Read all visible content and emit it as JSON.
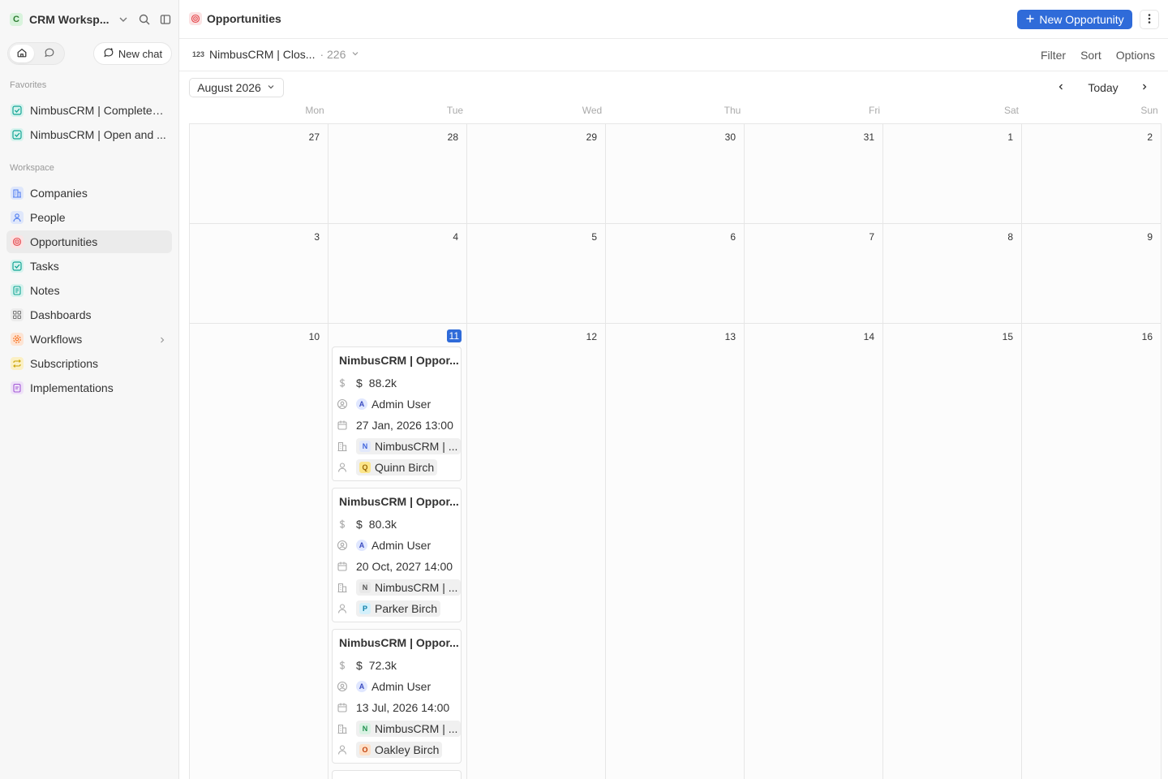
{
  "workspace": {
    "logo_letter": "C",
    "name": "CRM Worksp..."
  },
  "sidebar": {
    "new_chat_label": "New chat",
    "favorites_label": "Favorites",
    "favorites": [
      {
        "label": "NimbusCRM | Completed ...",
        "icon": "checkbox-icon"
      },
      {
        "label": "NimbusCRM | Open and ...",
        "icon": "checkbox-icon"
      }
    ],
    "workspace_label": "Workspace",
    "items": [
      {
        "label": "Companies",
        "icon": "building-icon",
        "color": "#4f7df0",
        "bg": "#dfe7fb"
      },
      {
        "label": "People",
        "icon": "user-icon",
        "color": "#4f7df0",
        "bg": "#dfe7fb"
      },
      {
        "label": "Opportunities",
        "icon": "target-icon",
        "color": "#e5484d",
        "bg": "#fbe3e4",
        "active": true
      },
      {
        "label": "Tasks",
        "icon": "checkbox-icon",
        "color": "#12a594",
        "bg": "#d6f3ee"
      },
      {
        "label": "Notes",
        "icon": "note-icon",
        "color": "#12a594",
        "bg": "#d6f3ee"
      },
      {
        "label": "Dashboards",
        "icon": "dashboard-icon",
        "color": "#777",
        "bg": "#ececec"
      },
      {
        "label": "Workflows",
        "icon": "settings-icon",
        "color": "#f76b15",
        "bg": "#fde4d4"
      },
      {
        "label": "Subscriptions",
        "icon": "repeat-icon",
        "color": "#c9a100",
        "bg": "#fbf0c4"
      },
      {
        "label": "Implementations",
        "icon": "clipboard-icon",
        "color": "#a35ad6",
        "bg": "#efe2f8"
      }
    ]
  },
  "header": {
    "title": "Opportunities",
    "new_button_label": "New Opportunity"
  },
  "view": {
    "name": "NimbusCRM | Clos...",
    "count": "· 226",
    "actions": [
      "Filter",
      "Sort",
      "Options"
    ]
  },
  "calendar": {
    "month_label": "August 2026",
    "today_label": "Today",
    "weekdays": [
      "Mon",
      "Tue",
      "Wed",
      "Thu",
      "Fri",
      "Sat",
      "Sun"
    ],
    "weeks": [
      [
        "27",
        "28",
        "29",
        "30",
        "31",
        "1",
        "2"
      ],
      [
        "3",
        "4",
        "5",
        "6",
        "7",
        "8",
        "9"
      ],
      [
        "10",
        "11",
        "12",
        "13",
        "14",
        "15",
        "16"
      ]
    ],
    "today_day": "11"
  },
  "cards": [
    {
      "title": "NimbusCRM | Oppor...",
      "amount": "88.2k",
      "owner": {
        "letter": "A",
        "name": "Admin User"
      },
      "date": "27 Jan, 2026 13:00",
      "company": {
        "letter": "N",
        "name": "NimbusCRM | ...",
        "color": "#3e63dd",
        "bg": "#e1e8fb"
      },
      "contact": {
        "letter": "Q",
        "name": "Quinn Birch",
        "color": "#9a6700",
        "bg": "#fbe58a"
      }
    },
    {
      "title": "NimbusCRM | Oppor...",
      "amount": "80.3k",
      "owner": {
        "letter": "A",
        "name": "Admin User"
      },
      "date": "20 Oct, 2027 14:00",
      "company": {
        "letter": "N",
        "name": "NimbusCRM | ...",
        "color": "#555",
        "bg": "#e8e8e8"
      },
      "contact": {
        "letter": "P",
        "name": "Parker Birch",
        "color": "#0b7ea8",
        "bg": "#d3f0fb"
      }
    },
    {
      "title": "NimbusCRM | Oppor...",
      "amount": "72.3k",
      "owner": {
        "letter": "A",
        "name": "Admin User"
      },
      "date": "13 Jul, 2026 14:00",
      "company": {
        "letter": "N",
        "name": "NimbusCRM | ...",
        "color": "#1f8f4e",
        "bg": "#d9f2e3"
      },
      "contact": {
        "letter": "O",
        "name": "Oakley Birch",
        "color": "#c2410c",
        "bg": "#fde0c8"
      }
    }
  ],
  "colors": {
    "accent": "#2f6bd9"
  }
}
